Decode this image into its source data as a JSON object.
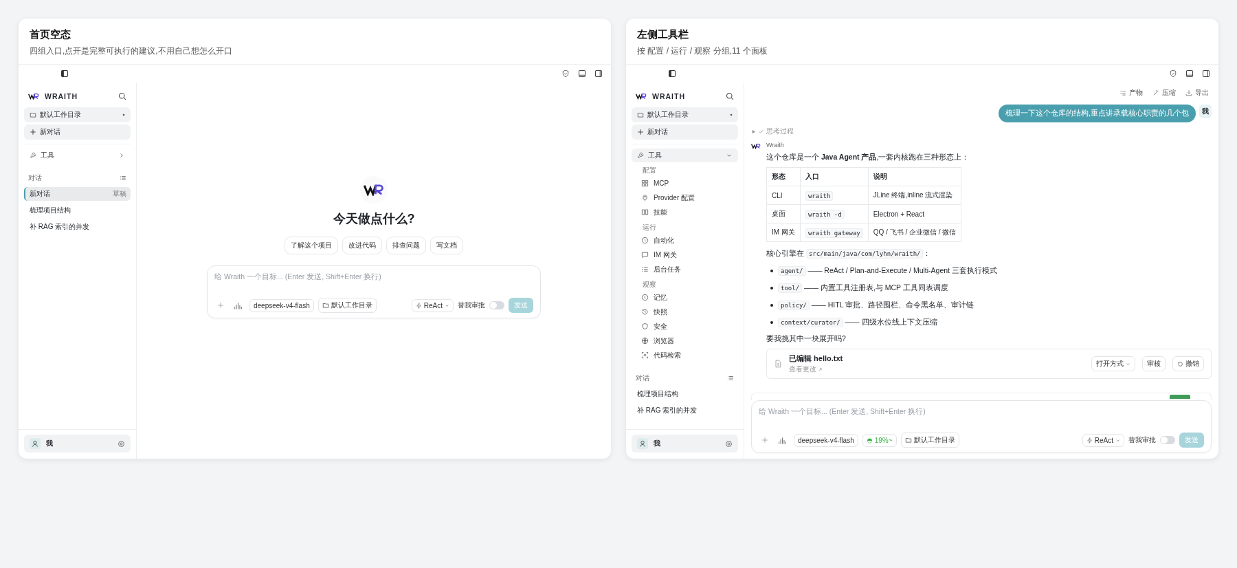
{
  "panels": [
    {
      "kind": "empty",
      "title": "首页空态",
      "subtitle": "四组入口,点开是完整可执行的建议,不用自己想怎么开口",
      "sidebar": {
        "brand": "WRAITH",
        "workspace": "默认工作目录",
        "new_chat": "新对话",
        "tools": {
          "label": "工具",
          "expanded": false
        },
        "conversations_label": "对话",
        "conversations": [
          {
            "title": "新对话",
            "badge": "草稿",
            "selected": true
          },
          {
            "title": "梳理项目结构",
            "selected": false
          },
          {
            "title": "补 RAG 索引的并发",
            "selected": false
          }
        ],
        "user": "我"
      },
      "empty_state": {
        "heading": "今天做点什么?",
        "suggestions": [
          "了解这个项目",
          "改进代码",
          "排查问题",
          "写文档"
        ]
      },
      "composer": {
        "placeholder": "给 Wraith 一个目标... (Enter 发送, Shift+Enter 换行)",
        "model": "deepseek-v4-flash",
        "folder": "默认工作目录",
        "mode": "ReAct",
        "auto_approve_label": "替我审批",
        "auto_approve_on": false,
        "send": "发送",
        "send_disabled": true
      }
    },
    {
      "kind": "chat",
      "title": "左侧工具栏",
      "subtitle": "按 配置 / 运行 / 观察 分组,11 个面板",
      "sidebar": {
        "brand": "WRAITH",
        "workspace": "默认工作目录",
        "new_chat": "新对话",
        "tools": {
          "label": "工具",
          "expanded": true,
          "groups": [
            {
              "label": "配置",
              "items": [
                "MCP",
                "Provider 配置",
                "技能"
              ]
            },
            {
              "label": "运行",
              "items": [
                "自动化",
                "IM 网关",
                "后台任务"
              ]
            },
            {
              "label": "观察",
              "items": [
                "记忆",
                "快照",
                "安全",
                "浏览器",
                "代码检索"
              ]
            }
          ]
        },
        "conversations_label": "对话",
        "conversations": [
          {
            "title": "梳理项目结构",
            "selected": false
          },
          {
            "title": "补 RAG 索引的并发",
            "selected": false
          }
        ],
        "user": "我"
      },
      "chat": {
        "actions": [
          "产物",
          "压缩",
          "导出"
        ],
        "user_message": "梳理一下这个仓库的结构,重点讲承载核心职责的几个包",
        "user_avatar": "我",
        "thinking": {
          "label": "思考过程",
          "expanded": false
        },
        "assistant_name": "Wraith",
        "intro": "这个仓库是一个 **Java Agent 产品**,一套内核跑在三种形态上：",
        "table": {
          "columns": [
            "形态",
            "入口",
            "说明"
          ],
          "rows": [
            [
              "CLI",
              "wraith",
              "JLine 终端,inline 流式渲染"
            ],
            [
              "桌面",
              "wraith -d",
              "Electron + React"
            ],
            [
              "IM 网关",
              "wraith gateway",
              "QQ / 飞书 / 企业微信 / 微信"
            ]
          ]
        },
        "engine": {
          "text": "核心引擎在",
          "code": "src/main/java/com/lyhn/wraith/",
          "after": "："
        },
        "bullets": [
          {
            "code": "agent/",
            "text": "—— ReAct / Plan-and-Execute / Multi-Agent 三套执行模式"
          },
          {
            "code": "tool/",
            "text": "—— 内置工具注册表,与 MCP 工具同表调度"
          },
          {
            "code": "policy/",
            "text": "—— HITL 审批、路径围栏、命令黑名单、审计链"
          },
          {
            "code": "context/curator/",
            "text": "—— 四级水位线上下文压缩"
          }
        ],
        "question": "要我挑其中一块展开吗?",
        "file_card": {
          "title": "已编辑 hello.txt",
          "link": "查看更改",
          "buttons": [
            {
              "label": "打开方式",
              "kind": "dropdown"
            },
            {
              "label": "审核",
              "kind": "plain"
            },
            {
              "label": "撤销",
              "kind": "undo"
            }
          ]
        }
      },
      "composer": {
        "placeholder": "给 Wraith 一个目标... (Enter 发送, Shift+Enter 换行)",
        "model": "deepseek-v4-flash",
        "context_usage": "19%~",
        "folder": "默认工作目录",
        "mode": "ReAct",
        "auto_approve_label": "替我审批",
        "auto_approve_on": false,
        "send": "发送",
        "send_disabled": true
      }
    }
  ]
}
